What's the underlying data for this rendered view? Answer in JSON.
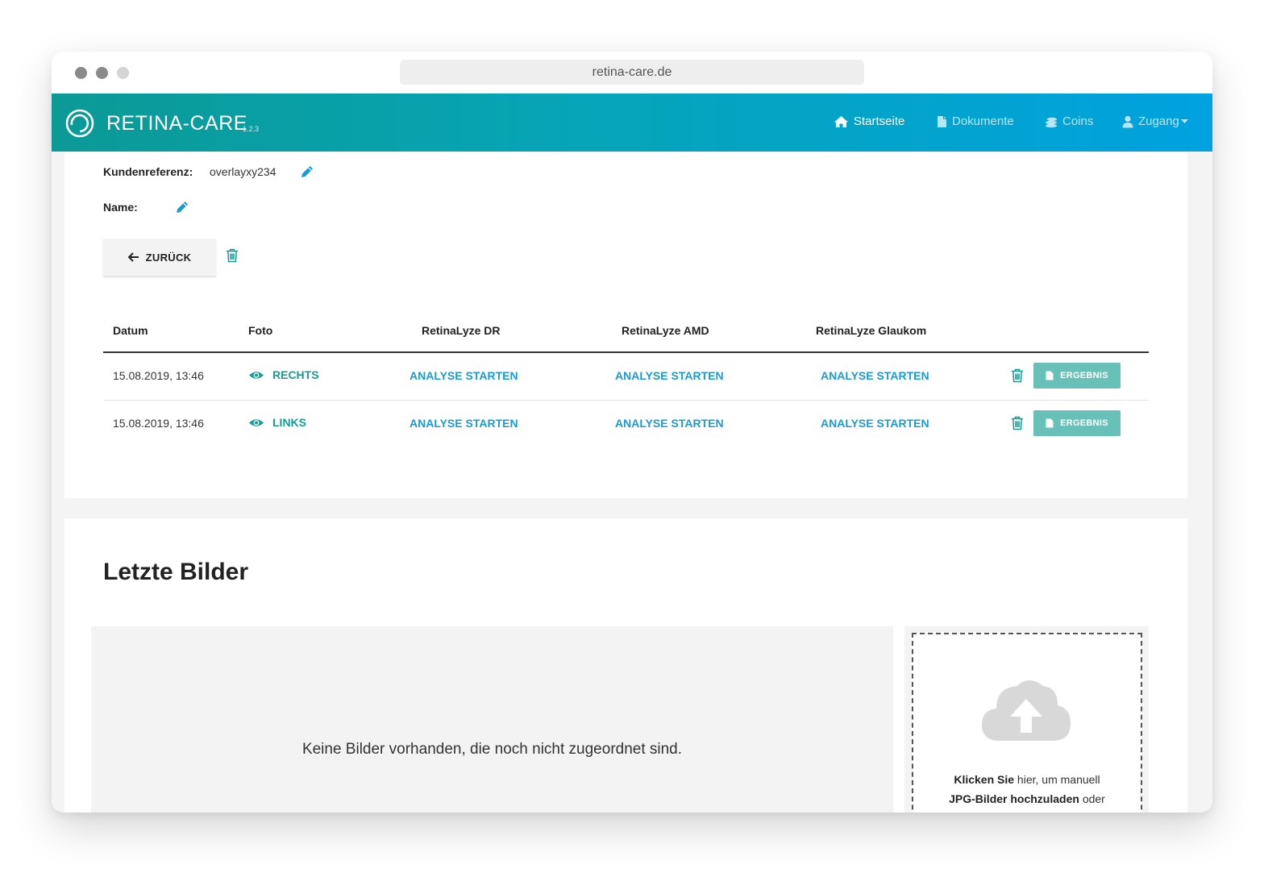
{
  "browser": {
    "url": "retina-care.de"
  },
  "navbar": {
    "brand": "RETINA-CARE",
    "version": "1.2.3",
    "items": [
      {
        "label": "Startseite",
        "icon": "home-icon"
      },
      {
        "label": "Dokumente",
        "icon": "document-icon"
      },
      {
        "label": "Coins",
        "icon": "coins-icon"
      },
      {
        "label": "Zugang",
        "icon": "user-icon"
      }
    ]
  },
  "patient": {
    "kundenreferenz_label": "Kundenreferenz:",
    "kundenreferenz_value": "overlayxy234",
    "name_label": "Name:",
    "name_value": "",
    "back_label": "ZURÜCK"
  },
  "table": {
    "headers": [
      "Datum",
      "Foto",
      "RetinaLyze DR",
      "RetinaLyze AMD",
      "RetinaLyze Glaukom"
    ],
    "rows": [
      {
        "datum": "15.08.2019, 13:46",
        "foto": "RECHTS",
        "dr": "ANALYSE STARTEN",
        "amd": "ANALYSE STARTEN",
        "glaukom": "ANALYSE STARTEN",
        "ergebnis": "ERGEBNIS"
      },
      {
        "datum": "15.08.2019, 13:46",
        "foto": "LINKS",
        "dr": "ANALYSE STARTEN",
        "amd": "ANALYSE STARTEN",
        "glaukom": "ANALYSE STARTEN",
        "ergebnis": "ERGEBNIS"
      }
    ]
  },
  "images_section": {
    "title": "Letzte Bilder",
    "empty_message": "Keine Bilder vorhanden, die noch nicht zugeordnet sind.",
    "upload_bold_1": "Klicken Sie",
    "upload_text_1": " hier, um manuell",
    "upload_bold_2": "JPG-Bilder hochzuladen",
    "upload_text_2": " oder"
  },
  "colors": {
    "teal": "#139d96",
    "link_blue": "#1a9bd6",
    "ergebnis_bg": "#68c1b9",
    "navbar_start": "#0b9a95",
    "navbar_end": "#00a2e0"
  }
}
